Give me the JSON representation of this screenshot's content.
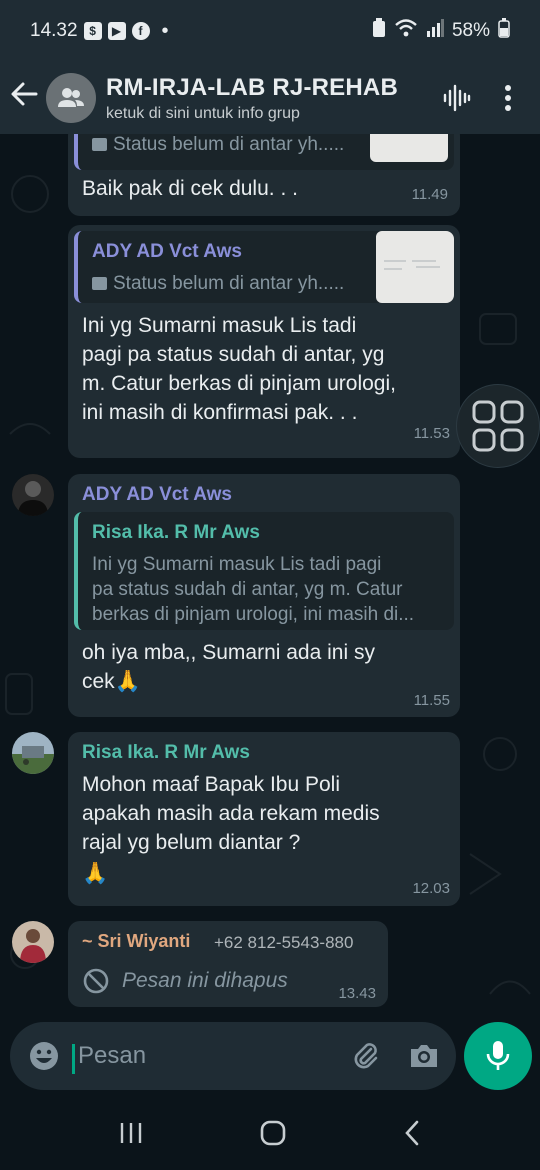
{
  "status_bar": {
    "time": "14.32",
    "battery": "58%"
  },
  "header": {
    "title": "RM-IRJA-LAB RJ-REHAB",
    "subtitle": "ketuk di sini untuk info grup"
  },
  "messages": [
    {
      "quote_text": "Status belum di antar yh.....",
      "text": "Baik pak di cek dulu. . .",
      "time": "11.49"
    },
    {
      "quote_author": "ADY AD Vct Aws",
      "quote_text": "Status belum di antar yh.....",
      "text_lines": [
        "Ini yg Sumarni masuk Lis tadi",
        "pagi pa status sudah di antar, yg",
        "m. Catur berkas di pinjam urologi,",
        "ini masih di konfirmasi pak. . ."
      ],
      "time": "11.53"
    },
    {
      "author": "ADY AD Vct Aws",
      "quote_author": "Risa Ika. R Mr Aws",
      "quote_lines": [
        "Ini yg Sumarni masuk Lis tadi pagi",
        "pa status sudah di antar, yg m. Catur",
        "berkas di pinjam urologi, ini masih di..."
      ],
      "text_lines": [
        "oh iya mba,, Sumarni ada ini sy",
        "cek🙏"
      ],
      "time": "11.55"
    },
    {
      "author": "Risa Ika. R Mr Aws",
      "text_lines": [
        "Mohon maaf Bapak Ibu Poli",
        "apakah masih ada  rekam medis",
        "rajal yg belum diantar ?",
        "🙏"
      ],
      "time": "12.03"
    },
    {
      "author": "~ Sri Wiyanti",
      "phone": "+62 812-5543-880",
      "text": "Pesan ini dihapus",
      "time": "13.43"
    }
  ],
  "input": {
    "placeholder": "Pesan"
  },
  "colors": {
    "accent": "#00a884",
    "author_purple": "#8a8fd9",
    "author_teal": "#53bdaa",
    "author_orange": "#e0a77f"
  }
}
